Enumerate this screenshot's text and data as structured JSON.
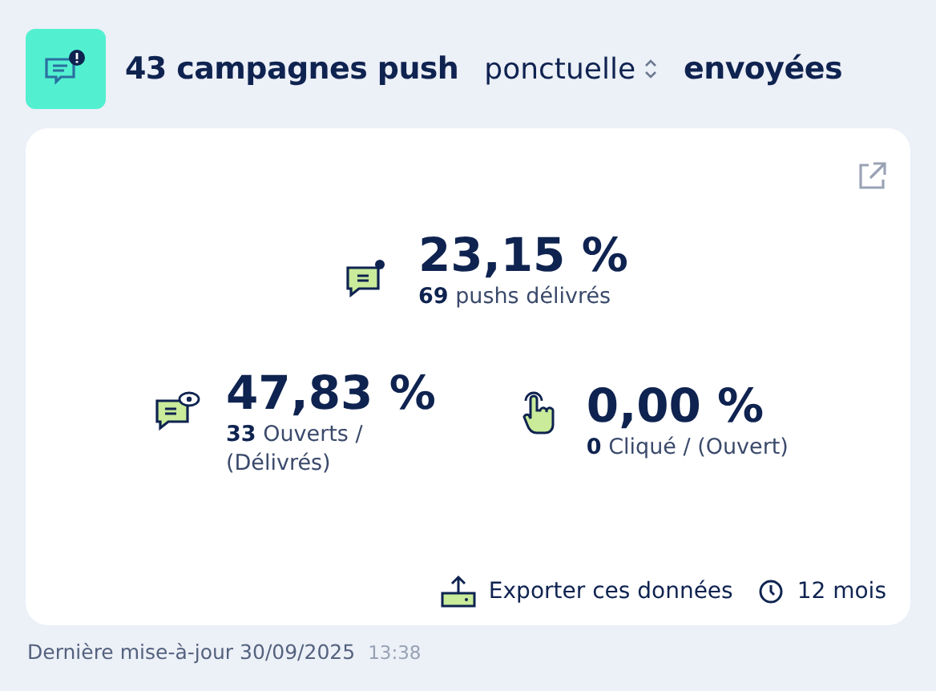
{
  "header": {
    "title": "43 campagnes push",
    "selector": {
      "value": "ponctuelle"
    },
    "suffix": "envoyées"
  },
  "stats": [
    {
      "kind": "delivered",
      "value": "23,15 %",
      "detail": "**69** pushs délivrés"
    },
    {
      "kind": "opened",
      "value": "47,83 %",
      "detail": "**33** Ouverts / (Délivrés)"
    },
    {
      "kind": "clicked",
      "value": "0,00 %",
      "detail": "**0** Cliqué / (Ouvert)"
    }
  ],
  "footer_actions": {
    "export": "Exporter ces données",
    "period": "12 mois"
  },
  "last_update": {
    "label": "Dernière mise-à-jour 30/09/2025",
    "time": "13:38"
  }
}
